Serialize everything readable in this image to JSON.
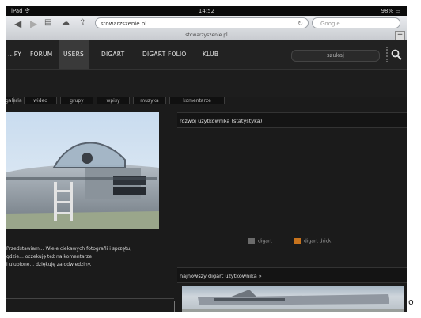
{
  "status_bar": {
    "left": "iPad 令",
    "time": "14:52",
    "right": "98% ▭"
  },
  "browser": {
    "url": "stowarzszenie.pl",
    "search_placeholder": "Google",
    "page_title": "stowarzyszenie.pl",
    "new_tab": "+"
  },
  "nav": {
    "items": [
      "...PY",
      "FORUM",
      "USERS",
      "DIGART",
      "DIGART FOLIO",
      "KLUB"
    ],
    "active": "USERS",
    "search_value": "szukaj"
  },
  "tabs": [
    "galeria",
    "wideo",
    "grupy",
    "wpisy",
    "muzyka",
    "komentarze"
  ],
  "left_text": [
    "Przedstawiam... Wiele ciekawych fotografii i sprzętu,",
    "gdzie... oczekuję też na komentarze",
    "i ulubione... dziękuję za odwiedziny."
  ],
  "panel_header": "rozwój użytkownika (statystyka)",
  "legend": [
    {
      "label": "digart",
      "color": "#6b6b6b"
    },
    {
      "label": "digart drick",
      "color": "#c7731d"
    }
  ],
  "latest_header": "najnowszy digart użytkownika »",
  "outside_char": "o"
}
